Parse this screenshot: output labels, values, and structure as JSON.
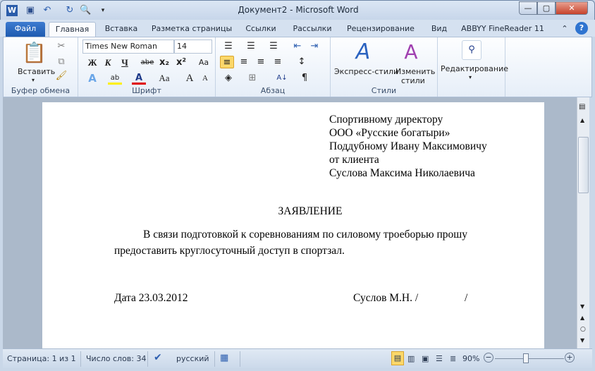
{
  "window": {
    "title": "Документ2 - Microsoft Word"
  },
  "tabs": {
    "file": "Файл",
    "items": [
      "Главная",
      "Вставка",
      "Разметка страницы",
      "Ссылки",
      "Рассылки",
      "Рецензирование",
      "Вид",
      "ABBYY FineReader 11"
    ]
  },
  "ribbon": {
    "clipboard": {
      "paste": "Вставить",
      "label": "Буфер обмена"
    },
    "font": {
      "name": "Times New Roman",
      "size": "14",
      "bold": "Ж",
      "italic": "К",
      "underline": "Ч",
      "strike": "abe",
      "label": "Шрифт"
    },
    "paragraph": {
      "label": "Абзац"
    },
    "styles": {
      "quick": "Экспресс-стили",
      "change": "Изменить",
      "change2": "стили",
      "label": "Стили"
    },
    "editing": {
      "label": "Редактирование"
    }
  },
  "document": {
    "addressee": [
      "Спортивному директору",
      "ООО «Русские богатыри»",
      "Поддубному Ивану Максимовичу",
      "от клиента",
      "Суслова Максима Николаевича"
    ],
    "heading": "ЗАЯВЛЕНИЕ",
    "body": [
      "В связи подготовкой к соревнованиям по силовому троеборью прошу",
      "предоставить круглосуточный доступ в спортзал."
    ],
    "date": "Дата 23.03.2012",
    "signature": "Суслов М.Н. /                 /"
  },
  "status": {
    "page": "Страница: 1 из 1",
    "words": "Число слов: 34",
    "language": "русский",
    "zoom": "90%",
    "zoom_percent": 90
  }
}
